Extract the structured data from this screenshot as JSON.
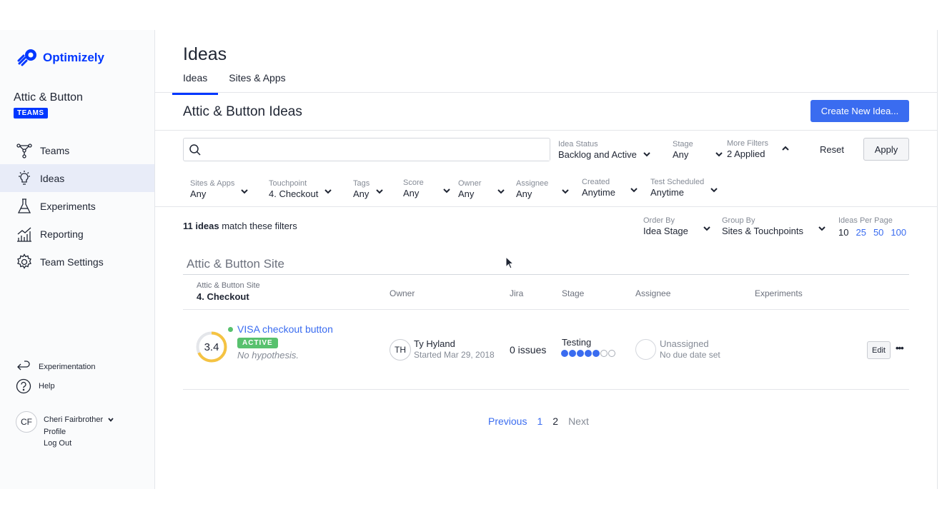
{
  "brand": {
    "name": "Optimizely",
    "color": "#0037ff"
  },
  "account": {
    "name": "Attic & Button",
    "badge": "TEAMS"
  },
  "nav": [
    {
      "label": "Teams",
      "icon": "teams-icon"
    },
    {
      "label": "Ideas",
      "icon": "lightbulb-icon",
      "active": true
    },
    {
      "label": "Experiments",
      "icon": "flask-icon"
    },
    {
      "label": "Reporting",
      "icon": "chart-icon"
    },
    {
      "label": "Team Settings",
      "icon": "gear-icon"
    }
  ],
  "side_links": {
    "experimentation": "Experimentation",
    "help": "Help"
  },
  "profile": {
    "initials": "CF",
    "name": "Cheri Fairbrother",
    "profile_link": "Profile",
    "logout": "Log Out"
  },
  "header": {
    "title": "Ideas",
    "tabs": [
      "Ideas",
      "Sites & Apps"
    ]
  },
  "section": {
    "title": "Attic & Button Ideas",
    "create_button": "Create New Idea..."
  },
  "search": {
    "placeholder": "",
    "value": ""
  },
  "filters_row1": {
    "idea_status": {
      "label": "Idea Status",
      "value": "Backlog and Active"
    },
    "stage": {
      "label": "Stage",
      "value": "Any"
    },
    "more_filters": {
      "label": "More Filters",
      "value": "2 Applied"
    },
    "reset": "Reset",
    "apply": "Apply"
  },
  "filters_row2": [
    {
      "label": "Sites & Apps",
      "value": "Any"
    },
    {
      "label": "Touchpoint",
      "value": "4. Checkout"
    },
    {
      "label": "Tags",
      "value": "Any"
    },
    {
      "label": "Score",
      "value": "Any"
    },
    {
      "label": "Owner",
      "value": "Any"
    },
    {
      "label": "Assignee",
      "value": "Any"
    },
    {
      "label": "Created",
      "value": "Anytime"
    },
    {
      "label": "Test Scheduled",
      "value": "Anytime"
    }
  ],
  "results": {
    "count_bold": "11 ideas",
    "count_rest": " match these filters",
    "order_by": {
      "label": "Order By",
      "value": "Idea Stage"
    },
    "group_by": {
      "label": "Group By",
      "value": "Sites & Touchpoints"
    },
    "per_page": {
      "label": "Ideas Per Page",
      "options": [
        "10",
        "25",
        "50",
        "100"
      ],
      "selected": "10"
    }
  },
  "group": {
    "title": "Attic & Button Site",
    "header": {
      "site": "Attic & Button Site",
      "touchpoint": "4. Checkout",
      "owner": "Owner",
      "jira": "Jira",
      "stage": "Stage",
      "assignee": "Assignee",
      "experiments": "Experiments"
    }
  },
  "idea": {
    "score": "3.4",
    "score_fraction": 0.68,
    "name": "VISA checkout button",
    "status": "ACTIVE",
    "hypothesis": "No hypothesis.",
    "owner_initials": "TH",
    "owner_name": "Ty Hyland",
    "owner_started": "Started Mar 29, 2018",
    "jira": "0 issues",
    "stage": "Testing",
    "stage_progress": {
      "completed": 5,
      "total": 7
    },
    "assignee": "Unassigned",
    "due": "No due date set",
    "edit": "Edit",
    "more": "•••"
  },
  "pager": {
    "previous": "Previous",
    "pages": [
      "1",
      "2"
    ],
    "current": "2",
    "next": "Next"
  },
  "colors": {
    "accent": "#3a6cf0",
    "active_green": "#58c16e",
    "score_ring": "#f5c342"
  }
}
